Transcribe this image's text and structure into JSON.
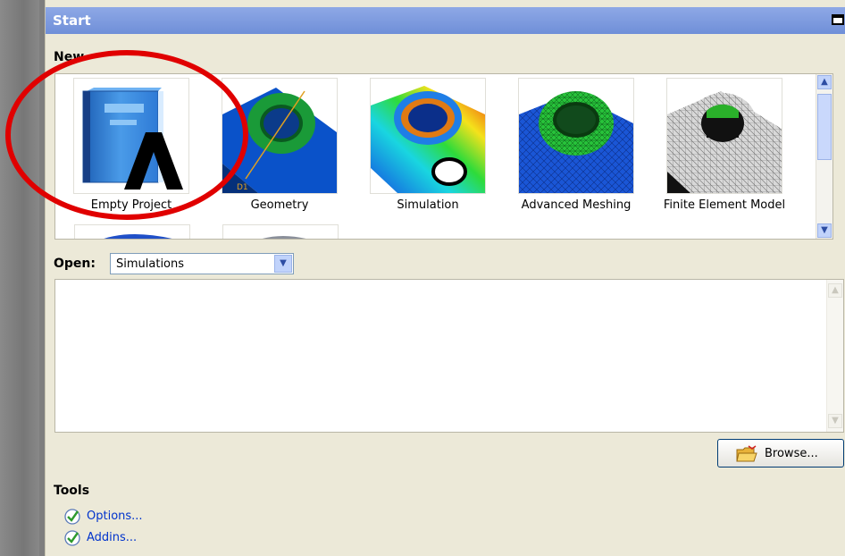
{
  "panel": {
    "title": "Start"
  },
  "new_section": {
    "label": "New",
    "tiles": [
      {
        "label": "Empty Project",
        "icon": "empty-project-icon"
      },
      {
        "label": "Geometry",
        "icon": "geometry-icon"
      },
      {
        "label": "Simulation",
        "icon": "simulation-icon"
      },
      {
        "label": "Advanced Meshing",
        "icon": "advanced-meshing-icon"
      },
      {
        "label": "Finite Element Model",
        "icon": "finite-element-model-icon"
      }
    ]
  },
  "open_section": {
    "label": "Open:",
    "selected": "Simulations"
  },
  "browse": {
    "label": "Browse..."
  },
  "tools": {
    "label": "Tools",
    "items": [
      {
        "label": "Options...",
        "icon": "check-icon"
      },
      {
        "label": "Addins...",
        "icon": "check-icon"
      }
    ]
  },
  "colors": {
    "titlebar": "#7894dc",
    "panel_bg": "#ece9d8",
    "annotation": "#e00000",
    "link": "#0033cc"
  }
}
